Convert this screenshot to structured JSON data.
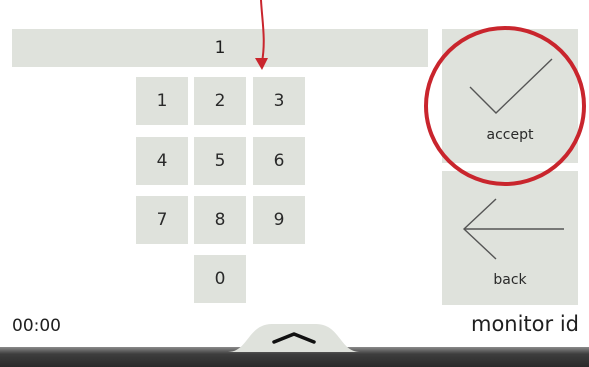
{
  "display": {
    "value": "1"
  },
  "keypad": {
    "k1": "1",
    "k2": "2",
    "k3": "3",
    "k4": "4",
    "k5": "5",
    "k6": "6",
    "k7": "7",
    "k8": "8",
    "k9": "9",
    "k0": "0"
  },
  "side": {
    "accept_label": "accept",
    "back_label": "back"
  },
  "status": {
    "time": "00:00",
    "screen_label": "monitor id"
  },
  "icons": {
    "accept": "checkmark-icon",
    "back": "arrow-left-icon",
    "tab": "chevron-up-icon"
  },
  "colors": {
    "key_bg": "#dfe2dc",
    "annotation": "#c9252d"
  }
}
